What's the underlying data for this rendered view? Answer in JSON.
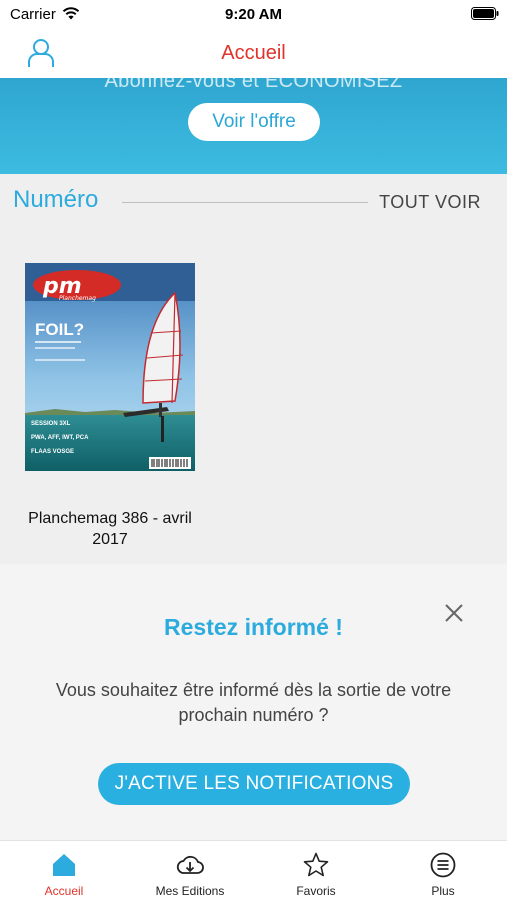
{
  "status_bar": {
    "carrier": "Carrier",
    "time": "9:20 AM"
  },
  "nav": {
    "title": "Accueil"
  },
  "promo": {
    "text": "Abonnez-vous et ÉCONOMISEZ",
    "button_label": "Voir l'offre"
  },
  "section": {
    "title": "Numéro",
    "see_all": "TOUT VOIR"
  },
  "issues": [
    {
      "title": "Planchemag 386 - avril 2017",
      "cover_text": {
        "logo": "pm",
        "logo_sub": "Planchemag",
        "headline": "FOIL?",
        "lines": [
          "SESSION 3XL",
          "PWA, AFF, IWT, PCA",
          "FLAAS VOSGE"
        ]
      }
    }
  ],
  "notify": {
    "heading": "Restez informé !",
    "body": "Vous souhaitez être informé dès la sortie de votre prochain numéro ?",
    "button_label": "J'ACTIVE LES NOTIFICATIONS"
  },
  "tabs": [
    {
      "label": "Accueil",
      "icon": "home-icon",
      "active": true
    },
    {
      "label": "Mes Editions",
      "icon": "cloud-download-icon",
      "active": false
    },
    {
      "label": "Favoris",
      "icon": "star-icon",
      "active": false
    },
    {
      "label": "Plus",
      "icon": "menu-icon",
      "active": false
    }
  ],
  "colors": {
    "accent_blue": "#2cabde",
    "accent_red": "#e1332b"
  }
}
